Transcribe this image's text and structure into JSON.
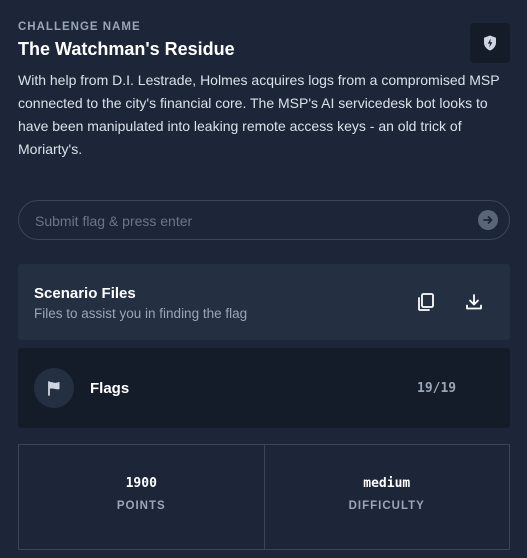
{
  "challenge": {
    "section_label": "CHALLENGE NAME",
    "title": "The Watchman's Residue",
    "description": "With help from D.I. Lestrade, Holmes acquires logs from a compromised MSP connected to the city's financial core. The MSP's AI servicedesk bot looks to have been manipulated into leaking remote access keys - an old trick of Moriarty's.",
    "badge_icon": "shield-icon"
  },
  "flag_input": {
    "placeholder": "Submit flag & press enter",
    "value": "",
    "submit_icon": "arrow-right-icon"
  },
  "scenario_files": {
    "title": "Scenario Files",
    "subtitle": "Files to assist you in finding the flag",
    "copy_icon": "copy-icon",
    "download_icon": "download-icon"
  },
  "flags": {
    "label": "Flags",
    "count": "19/19",
    "icon": "flag-icon"
  },
  "stats": {
    "points_value": "1900",
    "points_label": "POINTS",
    "difficulty_value": "medium",
    "difficulty_label": "DIFFICULTY"
  },
  "colors": {
    "background": "#1c2638",
    "card": "#243042",
    "card_dark": "#141c2a",
    "muted_text": "#9aa6b8",
    "border": "#3a4558"
  }
}
